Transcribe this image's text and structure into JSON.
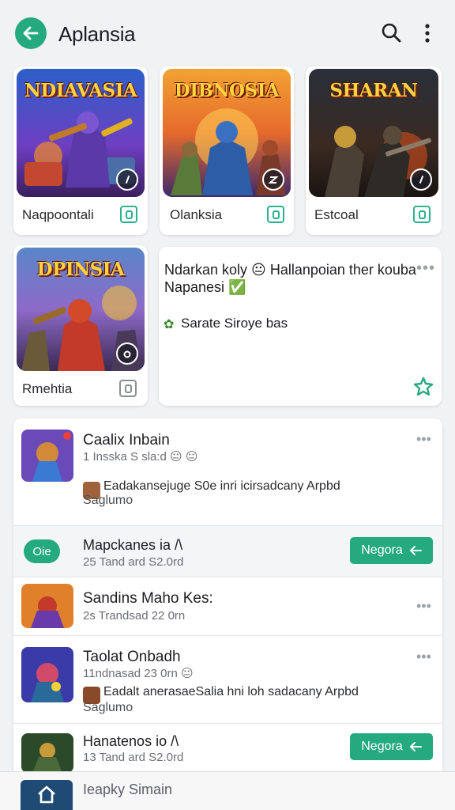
{
  "app": {
    "title": "Aplansia"
  },
  "colors": {
    "accent": "#25a97e",
    "background": "#f1f2f4",
    "card": "#ffffff"
  },
  "grid": {
    "cards": [
      {
        "thumb_title": "NDIAVASIA",
        "label": "Naqpoontali"
      },
      {
        "thumb_title": "DIBNOSIA",
        "label": "Olanksia"
      },
      {
        "thumb_title": "SHARAN",
        "label": "Estcoal"
      },
      {
        "thumb_title": "DPINSIA",
        "label": "Rmehtia"
      }
    ]
  },
  "feature": {
    "line1": "Ndarkan koly 😐 Hallanpoian ther kouba",
    "line2": "Napanesi ✅",
    "line3": "Sarate Siroye bas",
    "more": "•••"
  },
  "list": {
    "items": [
      {
        "title": "Caalix Inbain",
        "subtitle": "1 Insska S sla:d 😐 😐",
        "desc": "Eadakansejuge S0e inri icirsadcany Arpbd",
        "desc2": "Saglumo",
        "more": "•••"
      },
      {
        "pill": "Oie",
        "title": "Mapckanes ia /\\",
        "subtitle": "25 Tand ard S2.0rd",
        "button": "Negora"
      },
      {
        "title": "Sandins Maho Kes:",
        "subtitle": "2s Trandsad 22 0rn",
        "more": "•••"
      },
      {
        "title": "Taolat Onbadh",
        "subtitle": "11ndnasad 23 0rn 😐",
        "desc": "Eadalt anerasaeSalia hni loh sadacany Arpbd",
        "desc2": "Saglumo",
        "more": "•••"
      },
      {
        "title": "Hanatenos io /\\",
        "subtitle": "13 Tand ard S2.0rd",
        "button": "Negora"
      }
    ]
  },
  "bottom_nav": {
    "label": "Ieapky Simain"
  }
}
